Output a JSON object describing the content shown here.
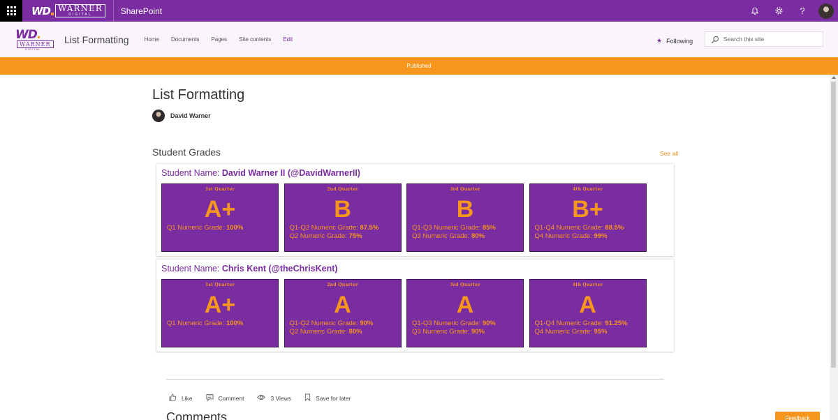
{
  "suite": {
    "logo_wd": "WD",
    "logo_brand": "WARNER",
    "logo_digital": "DIGITAL",
    "app_title": "SharePoint",
    "icons": [
      "bell-icon",
      "gear-icon",
      "help-icon"
    ]
  },
  "site": {
    "logo_wd": "WD",
    "logo_brand": "WARNER",
    "logo_digital": "DIGITAL",
    "title": "List Formatting",
    "nav": [
      "Home",
      "Documents",
      "Pages",
      "Site contents",
      "Edit"
    ],
    "following": "Following",
    "search_placeholder": "Search this site"
  },
  "status_bar": {
    "text": "Published"
  },
  "page": {
    "title": "List Formatting",
    "author": "David Warner"
  },
  "section": {
    "title": "Student Grades",
    "see_all": "See all"
  },
  "students": [
    {
      "label": "Student Name: ",
      "name": "David Warner II (@DavidWarnerII)",
      "quarters": [
        {
          "quarter": "1st Quarter",
          "grade": "A+",
          "l1_label": "Q1 Numeric Grade: ",
          "l1_value": "100%",
          "l2_label": "",
          "l2_value": ""
        },
        {
          "quarter": "2nd Quarter",
          "grade": "B",
          "l1_label": "Q1-Q2 Numeric Grade: ",
          "l1_value": "87.5%",
          "l2_label": "Q2 Numeric Grade: ",
          "l2_value": "75%"
        },
        {
          "quarter": "3rd Quarter",
          "grade": "B",
          "l1_label": "Q1-Q3 Numeric Grade: ",
          "l1_value": "85%",
          "l2_label": "Q3 Numeric Grade: ",
          "l2_value": "80%"
        },
        {
          "quarter": "4th Quarter",
          "grade": "B+",
          "l1_label": "Q1-Q4 Numeric Grade: ",
          "l1_value": "88.5%",
          "l2_label": "Q4 Numeric Grade: ",
          "l2_value": "99%"
        }
      ]
    },
    {
      "label": "Student Name: ",
      "name": "Chris Kent (@theChrisKent)",
      "quarters": [
        {
          "quarter": "1st Quarter",
          "grade": "A+",
          "l1_label": "Q1 Numeric Grade: ",
          "l1_value": "100%",
          "l2_label": "",
          "l2_value": ""
        },
        {
          "quarter": "2nd Quarter",
          "grade": "A",
          "l1_label": "Q1-Q2 Numeric Grade: ",
          "l1_value": "90%",
          "l2_label": "Q2 Numeric Grade: ",
          "l2_value": "80%"
        },
        {
          "quarter": "3rd Quarter",
          "grade": "A",
          "l1_label": "Q1-Q3 Numeric Grade: ",
          "l1_value": "90%",
          "l2_label": "Q3 Numeric Grade: ",
          "l2_value": "90%"
        },
        {
          "quarter": "4th Quarter",
          "grade": "A",
          "l1_label": "Q1-Q4 Numeric Grade: ",
          "l1_value": "91.25%",
          "l2_label": "Q4 Numeric Grade: ",
          "l2_value": "95%"
        }
      ]
    }
  ],
  "actions": {
    "like": "Like",
    "comment": "Comment",
    "views": "3 Views",
    "save": "Save for later"
  },
  "comments_heading": "Comments",
  "feedback": "Feedback",
  "colors": {
    "suite_purple": "#7a2da0",
    "accent_orange": "#f7961d",
    "tile_purple": "#7a2da0"
  }
}
